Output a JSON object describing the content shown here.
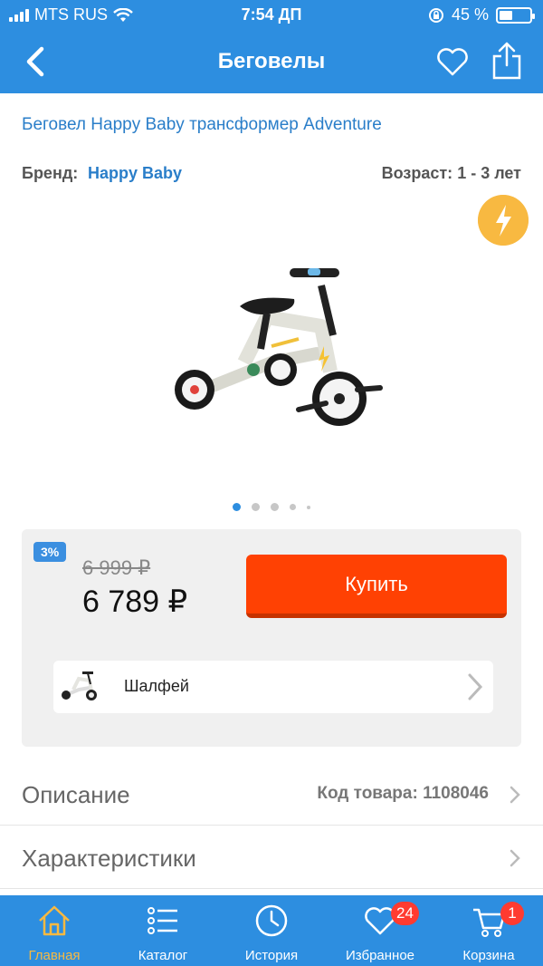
{
  "status_bar": {
    "carrier": "MTS RUS",
    "time": "7:54 ДП",
    "battery": "45 %",
    "battery_level": 0.45
  },
  "header": {
    "title": "Беговелы",
    "back_icon": "chevron-left-icon",
    "favorite_icon": "heart-icon",
    "share_icon": "share-icon"
  },
  "product": {
    "title": "Беговел Happy Baby трансформер Adventure",
    "brand_label": "Бренд:",
    "brand": "Happy Baby",
    "age_label": "Возраст:",
    "age": "1 - 3 лет",
    "badge_icon": "lightning-icon",
    "image_icon": "balance-bike-image"
  },
  "gallery": {
    "dots": 5,
    "active_index": 0
  },
  "price": {
    "discount": "3%",
    "old_price": "6 999 ₽",
    "new_price": "6 789 ₽",
    "buy_label": "Купить",
    "variant_label": "Шалфей"
  },
  "rows": {
    "description_label": "Описание",
    "sku": "Код товара: 1108046",
    "specs_label": "Характеристики"
  },
  "tabs": [
    {
      "label": "Главная",
      "icon": "home-icon",
      "active": true
    },
    {
      "label": "Каталог",
      "icon": "list-icon"
    },
    {
      "label": "История",
      "icon": "clock-icon"
    },
    {
      "label": "Избранное",
      "icon": "heart-icon",
      "badge": "24"
    },
    {
      "label": "Корзина",
      "icon": "cart-icon",
      "badge": "1"
    }
  ],
  "colors": {
    "primary": "#2d8ee0",
    "buy": "#ff4103",
    "accent": "#f8b941",
    "badge": "#ff3b30"
  }
}
